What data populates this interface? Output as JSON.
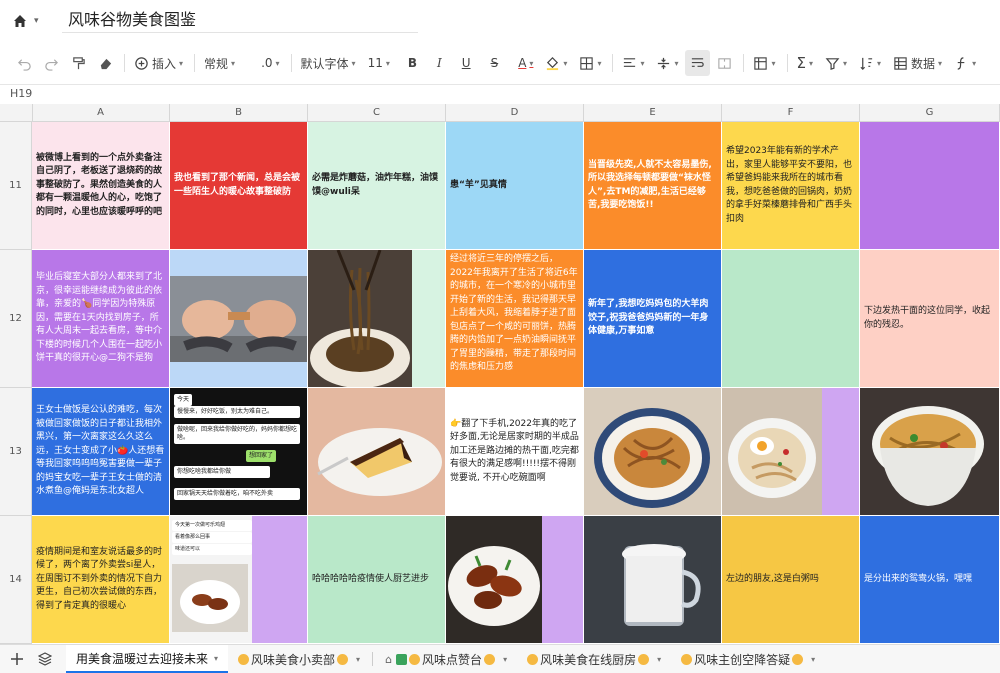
{
  "app": {
    "doc_title": "风味谷物美食图鉴",
    "cell_ref": "H19"
  },
  "toolbar": {
    "insert_label": "插入",
    "style_label": "常规",
    "decimal_label": ".0",
    "font_label": "默认字体",
    "size_label": "11",
    "bold_label": "B",
    "italic_label": "I",
    "underline_label": "U",
    "strike_label": "S",
    "color_label": "A",
    "data_label": "数据"
  },
  "columns": [
    "A",
    "B",
    "C",
    "D",
    "E",
    "F",
    "G"
  ],
  "rows": [
    "11",
    "12",
    "13",
    "14"
  ],
  "cells": {
    "A11": "被微博上看到的一个点外卖备注自己阴了，老板送了退烧药的故事整破防了。果然创造美食的人都有一颗温暖他人的心，吃饱了的同时，心里也应该暖呼呼的吧",
    "B11": "我也看到了那个新闻，总是会被一些陌生人的暖心故事整破防",
    "C11": "必需是炸蘑菇，油炸年糕，油馍馍@wuli呆",
    "D11": "患“羊”见真情",
    "E11": "当晋级先奕,人就不太容易墨伤,所以我选择每顿都要做“袜水怪人”,去TM的减肥,生活已经够苦,我要吃饱饭!!",
    "F11": "希望2023年能有新的学术产出，家里人能够平安不要阳，也希望爸妈能来我所在的城市看我，想吃爸爸做的回锅肉，奶奶的拿手好菜榛蘑排骨和广西手头扣肉",
    "A12": "毕业后寝室大部分人都来到了北京，很幸运能继续成为彼此的依靠，亲爱的🍗同学因为特殊原因，需要在1天内找到房子，所有人大周末一起去看房，等中介下楼的时候几个人围在一起吃小饼干真的很开心@二狗不是狗",
    "D12": "经过将近三年的停摆之后，2022年我离开了生活了将近6年的城市，在一个寒冷的小城市里开始了新的生活，我记得那天早上刮着大风，我缩着脖子进了面包店点了一个咸的可丽饼，热腾腾的内馅加了一点奶油瞬间抚平了胃里的躁精，带走了那段时间的焦虑和压力感",
    "E12": "新年了,我想吃妈妈包的大羊肉饺子,祝我爸爸妈妈新的一年身体健康,万事如意",
    "G12": "下边发热干面的这位同学，收起你的残忍。",
    "A13": "王女士做饭是公认的难吃，每次被做回家做饭的日子都让我相外黑兴，第一次离家这么久这么远，王女士变成了小🍅人还想看等我回家呜呜呜冤害要做一辈子的妈宝女吃一辈子王女士做的清水煮鱼@俺妈是东北女超人",
    "D13": "👉翻了下手机,2022年真的吃了好多面,无论是居家时期的半成品加工还是路边摊的热干面,吃完都有很大的满足感啊!!!!!摆不得刚觉要说, 不开心吃碗面啊",
    "A14": "疫情期间是和室友说话最多的时候了，两个离了外卖尝si星人，在周围订不到外卖的情况下自力更生，自己初次尝试做的东西，得到了肯定真的很暖心",
    "C14": "哈哈哈哈哈疫情使人厨艺进步",
    "F14": "左边的朋友,这是白粥吗",
    "G14": "是分出来的鸳鸯火锅，嘿嘿"
  },
  "chat": {
    "top_tag": "今天",
    "b1": "慢慢来，好好吃饭，别太为难自己。",
    "b2": "做啥呢，回来我给你做好吃的，妈妈你都想吃啥。",
    "b3": "想回家了",
    "b4": "你想吃啥我都给你做",
    "b5": "回家锅天天给你做着吃，咱不吃外卖"
  },
  "chat2": {
    "line1": "今天第一次做可乐鸡翅",
    "line2": "看着像那么回事",
    "line3": "味道还可以"
  },
  "sheets": [
    "用美食温暖过去迎接未来",
    "风味美食小卖部",
    "风味点赞台",
    "风味美食在线厨房",
    "风味主创空降答疑"
  ],
  "colors": {
    "pink": "#fce4ec",
    "red": "#e53935",
    "mint": "#d7f3e2",
    "sky": "#9dd8f6",
    "orange": "#fb8c2a",
    "yellow": "#fdd84d",
    "purple": "#b877e8",
    "blue": "#2f6fe0",
    "green": "#b9e8c9",
    "peach": "#fed0c5",
    "lightblue": "#bcd8f7",
    "lemon": "#fde47a",
    "lilac": "#cfa6f2",
    "mustard": "#f6c744"
  }
}
